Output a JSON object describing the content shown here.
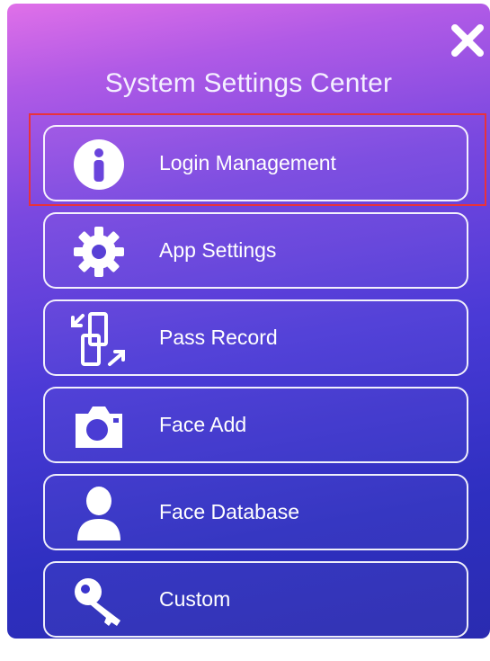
{
  "dialog": {
    "title": "System Settings Center"
  },
  "menu": {
    "items": [
      {
        "label": "Login Management",
        "icon": "info-icon"
      },
      {
        "label": "App Settings",
        "icon": "gear-icon"
      },
      {
        "label": "Pass Record",
        "icon": "pass-record-icon"
      },
      {
        "label": "Face Add",
        "icon": "camera-icon"
      },
      {
        "label": "Face Database",
        "icon": "person-icon"
      },
      {
        "label": "Custom",
        "icon": "key-icon"
      }
    ]
  },
  "colors": {
    "gradient_top": "#e070e8",
    "gradient_bottom": "#2a2bb0",
    "text": "#ffffff",
    "highlight": "#e8323c"
  }
}
